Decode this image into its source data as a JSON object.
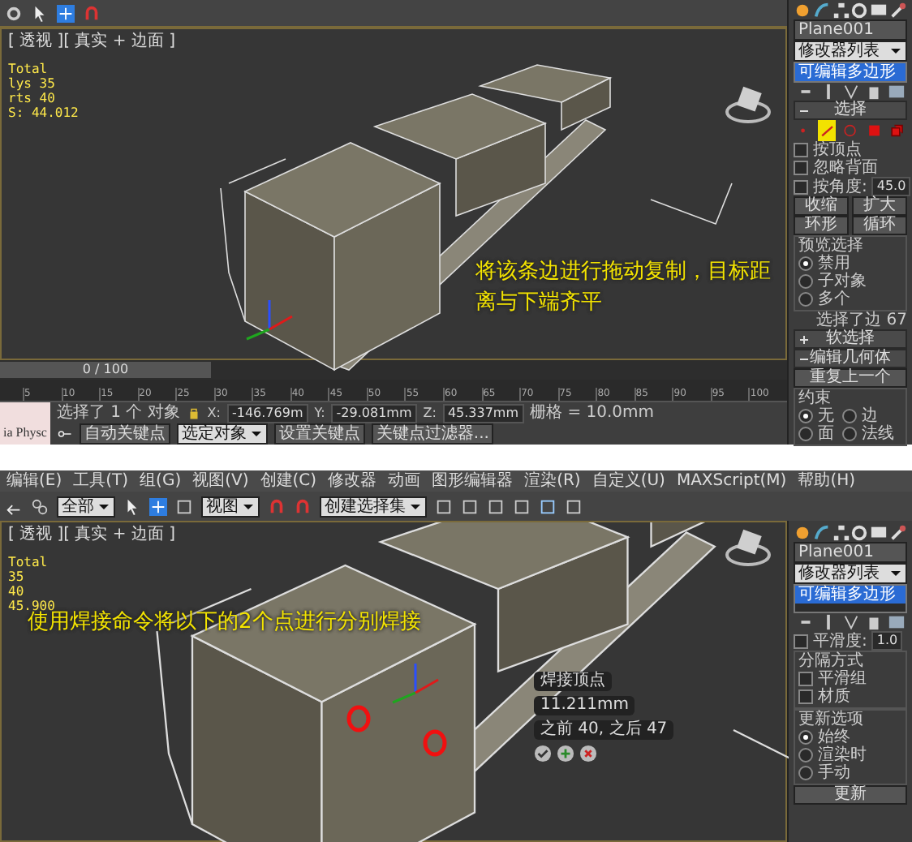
{
  "screens": [
    {
      "kind": "edge",
      "viewport": {
        "label": "[ 透视 ][ 真实 + 边面 ]",
        "stats": [
          "Total",
          "lys  35",
          "rts  40",
          "S:  44.012"
        ],
        "caption": "将该条边进行拖动复制，目标距离与下端齐平"
      },
      "panel": {
        "object_name": "Plane001",
        "modifier_list": "修改器列表",
        "stack": [
          {
            "label": "可编辑多边形",
            "selected": true
          }
        ],
        "rows": [
          {
            "kind": "rollout",
            "label": "选择",
            "expanded": true
          },
          {
            "kind": "subobjects",
            "items": [
              {
                "selected": false
              },
              {
                "selected": true
              },
              {
                "selected": false
              },
              {
                "selected": false
              },
              {
                "selected": false
              }
            ]
          },
          {
            "kind": "check",
            "label": "按顶点",
            "checked": false
          },
          {
            "kind": "check",
            "label": "忽略背面",
            "checked": false
          },
          {
            "kind": "check_field",
            "label": "按角度:",
            "checked": false,
            "value": "45.0"
          },
          {
            "kind": "buttons",
            "items": [
              "收缩",
              "扩大"
            ]
          },
          {
            "kind": "buttons",
            "items": [
              "环形",
              "循环"
            ]
          },
          {
            "kind": "group",
            "label": "预览选择",
            "options": [
              {
                "kind": "radio",
                "label": "禁用",
                "selected": true
              },
              {
                "kind": "radio",
                "label": "子对象",
                "selected": false
              },
              {
                "kind": "radio",
                "label": "多个",
                "selected": false
              }
            ]
          },
          {
            "kind": "text",
            "label": "选择了边 67"
          },
          {
            "kind": "rollout",
            "label": "软选择",
            "expanded": false
          },
          {
            "kind": "rollout",
            "label": "编辑几何体",
            "expanded": true
          },
          {
            "kind": "button",
            "label": "重复上一个"
          },
          {
            "kind": "group",
            "label": "约束",
            "options": [
              {
                "kind": "radio",
                "label": "无",
                "selected": true
              },
              {
                "kind": "radio",
                "label": "边",
                "selected": false
              },
              {
                "kind": "radio",
                "label": "面",
                "selected": false
              },
              {
                "kind": "radio",
                "label": "法线",
                "selected": false
              }
            ]
          }
        ]
      },
      "timeline": {
        "frame": "0 / 100",
        "ticks": [
          "5",
          "10",
          "15",
          "20",
          "25",
          "30",
          "35",
          "40",
          "45",
          "50",
          "55",
          "60",
          "65",
          "70",
          "75",
          "80",
          "85",
          "90",
          "95",
          "100"
        ]
      },
      "status": {
        "listener": "ia Physc",
        "prompt": "选择了 1 个 对象",
        "coords": [
          {
            "axis": "X:",
            "value": "-146.769m"
          },
          {
            "axis": "Y:",
            "value": "-29.081mm"
          },
          {
            "axis": "Z:",
            "value": "45.337mm"
          }
        ],
        "grid": "栅格 = 10.0mm",
        "auto_key": "自动关键点",
        "key_mode": "选定对象",
        "set_key": "设置关键点",
        "key_filter": "关键点过滤器..."
      }
    },
    {
      "kind": "vertex",
      "menu": [
        "编辑(E)",
        "工具(T)",
        "组(G)",
        "视图(V)",
        "创建(C)",
        "修改器",
        "动画",
        "图形编辑器",
        "渲染(R)",
        "自定义(U)",
        "MAXScript(M)",
        "帮助(H)"
      ],
      "dropdowns": [
        "全部",
        "视图",
        "创建选择集"
      ],
      "viewport": {
        "label": "[ 透视 ][ 真实 + 边面 ]",
        "stats": [
          "Total",
          "35",
          "40",
          "45.900"
        ],
        "caption": "使用焊接命令将以下的2个点进行分别焊接",
        "caddy": {
          "title": "焊接顶点",
          "value": "11.211mm",
          "info": "之前 40, 之后 47"
        }
      },
      "panel": {
        "object_name": "Plane001",
        "modifier_list": "修改器列表",
        "stack": [
          {
            "label": "可编辑多边形",
            "selected": true
          }
        ],
        "rows": [
          {
            "kind": "check_field",
            "label": "平滑度:",
            "checked": false,
            "value": "1.0"
          },
          {
            "kind": "group",
            "label": "分隔方式",
            "options": [
              {
                "kind": "check",
                "label": "平滑组",
                "checked": false
              },
              {
                "kind": "check",
                "label": "材质",
                "checked": false
              }
            ]
          },
          {
            "kind": "group",
            "label": "更新选项",
            "options": [
              {
                "kind": "radio",
                "label": "始终",
                "selected": true
              },
              {
                "kind": "radio",
                "label": "渲染时",
                "selected": false
              },
              {
                "kind": "radio",
                "label": "手动",
                "selected": false
              }
            ]
          },
          {
            "kind": "button",
            "label": "更新"
          }
        ]
      }
    }
  ]
}
